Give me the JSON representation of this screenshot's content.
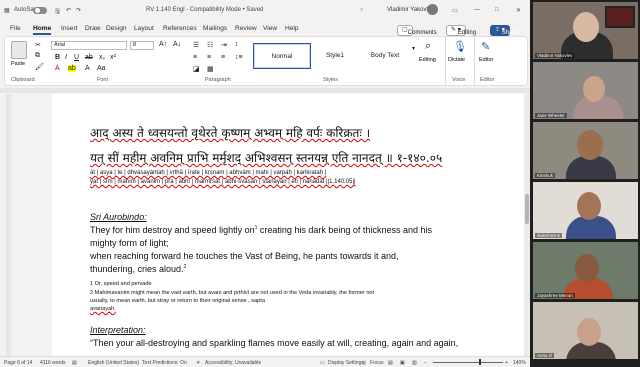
{
  "titlebar": {
    "autosave": "AutoSave",
    "autosave_state": "Off",
    "doc_title": "RV 1.140 Engl  -  Compatibility Mode  •  Saved",
    "user": "Vladimir Yakovlev"
  },
  "tabs": [
    "File",
    "Home",
    "Insert",
    "Draw",
    "Design",
    "Layout",
    "References",
    "Mailings",
    "Review",
    "View",
    "Help"
  ],
  "tab_active": "Home",
  "buttons": {
    "comments": "Comments",
    "editing_mode": "Editing",
    "share": "Share"
  },
  "ribbon": {
    "clipboard_label": "Clipboard",
    "paste": "Paste",
    "font_label": "Font",
    "paragraph_label": "Paragraph",
    "styles_label": "Styles",
    "voice_label": "Voice",
    "editor_label": "Editor",
    "font_name": "Arial",
    "font_size": "8",
    "styles": [
      "Normal",
      "Style1",
      "Body Text"
    ],
    "editing": "Editing",
    "dictate": "Dictate",
    "editor": "Editor"
  },
  "doc": {
    "sanskrit1": "आद् अस्य ते ध्वसयन्तो वृथेरते   कृष्णम् अभ्वम् महि वर्पः करिक्रतः ।",
    "sanskrit2": "यत् सीं महीम् अवनिम् प्राभि मर्मृशद्   अभिश्वसन् स्तनयन्न् एति नानदत् ॥ १-१४०.०५",
    "translit1": "āt | asya | te | dhvasayántaḥ | vṛthā | īrate | kṛṣṇam | abhvám | mahi | varpáḥ | karikrataḥ |",
    "translit2": "yat | sīm | mahīm | avanim | pra | abhi | marmṛśat | abhi-śvasan | stanayan | eti | nānādat ||1.140.05||",
    "heading1": "Sri Aurobindo:",
    "para1a": "They for him destroy and speed lightly on",
    "fn_mark1": "1",
    "para1b": " creating his dark being of thickness and his",
    "para2": "mighty form of light;",
    "para3": "when reaching forward he touches the Vast of Being, he pants towards it and,",
    "para4a": "thundering, cries aloud.",
    "fn_mark2": "2",
    "fn1": "1 Or, speed and pervade",
    "fn2": "2 Mahimavanim might mean the vast earth, but avani and pṛthivī are not used in the Veda invariably, the former not",
    "fn3": "usually, to mean earth, but stray or return to their original sense , sapta",
    "fn4": "avanayah.",
    "heading2": "Interpretation:",
    "para5": "“Then your all-destroying and sparkling flames move easily at will, creating, again and again,"
  },
  "status": {
    "page": "Page 6 of 14",
    "words": "4116 words",
    "lang": "English (United States)",
    "predictions": "Text Predictions: On",
    "accessibility": "Accessibility: Unavailable",
    "display": "Display Settings",
    "focus": "Focus",
    "zoom": "140%"
  },
  "participants": [
    {
      "name": "Vladimir Yakovlev"
    },
    {
      "name": "Jane Wheeler"
    },
    {
      "name": "Kinshuk"
    },
    {
      "name": "Sulochna S"
    },
    {
      "name": "Jayashree Menon"
    },
    {
      "name": "Anna G"
    }
  ],
  "colors": {
    "accent": "#2b579a",
    "sanskrit_underline": "#d00000"
  }
}
